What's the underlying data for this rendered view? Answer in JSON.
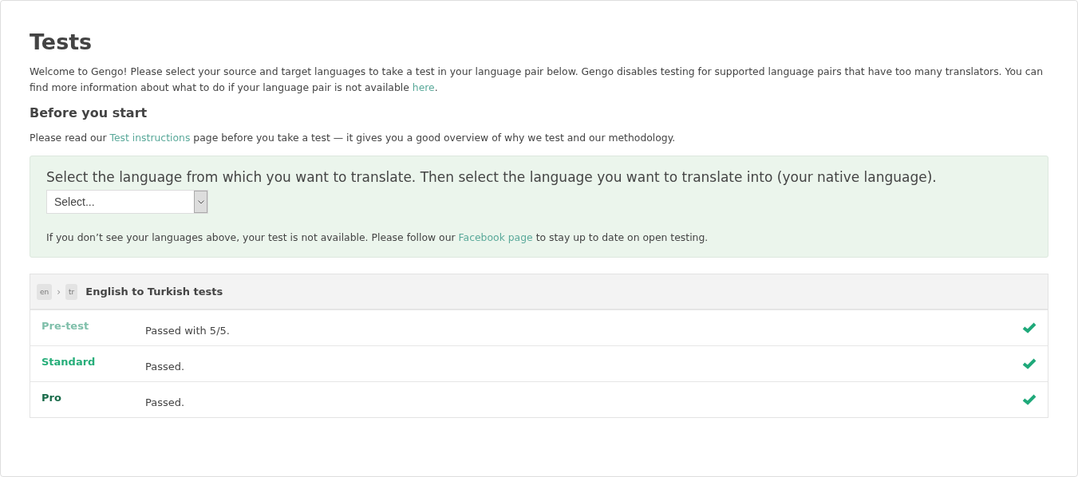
{
  "title": "Tests",
  "intro": {
    "before": "Welcome to Gengo! Please select your source and target languages to take a test in your language pair below. Gengo disables testing for supported language pairs that have too many translators. You can find more information about what to do if your language pair is not available ",
    "link": "here",
    "after": "."
  },
  "subtitle": "Before you start",
  "instructions": {
    "before": "Please read our ",
    "link": "Test instructions",
    "after": " page before you take a test — it gives you a good overview of why we test and our methodology."
  },
  "selector": {
    "heading": "Select the language from which you want to translate. Then select the language you want to translate into (your native language).",
    "value": "Select...",
    "note": {
      "before": "If you don’t see your languages above, your test is not available. Please follow our ",
      "link": "Facebook page",
      "after": " to stay up to date on open testing."
    }
  },
  "pair": {
    "source": "en",
    "separator": "›",
    "target": "tr",
    "title": "English to Turkish tests"
  },
  "tests": [
    {
      "name": "Pre-test",
      "color": "#7fbfaa",
      "result": "Passed with 5/5.",
      "passed": true
    },
    {
      "name": "Standard",
      "color": "#27ae7a",
      "result": "Passed.",
      "passed": true
    },
    {
      "name": "Pro",
      "color": "#1a6b4a",
      "result": "Passed.",
      "passed": true
    }
  ]
}
